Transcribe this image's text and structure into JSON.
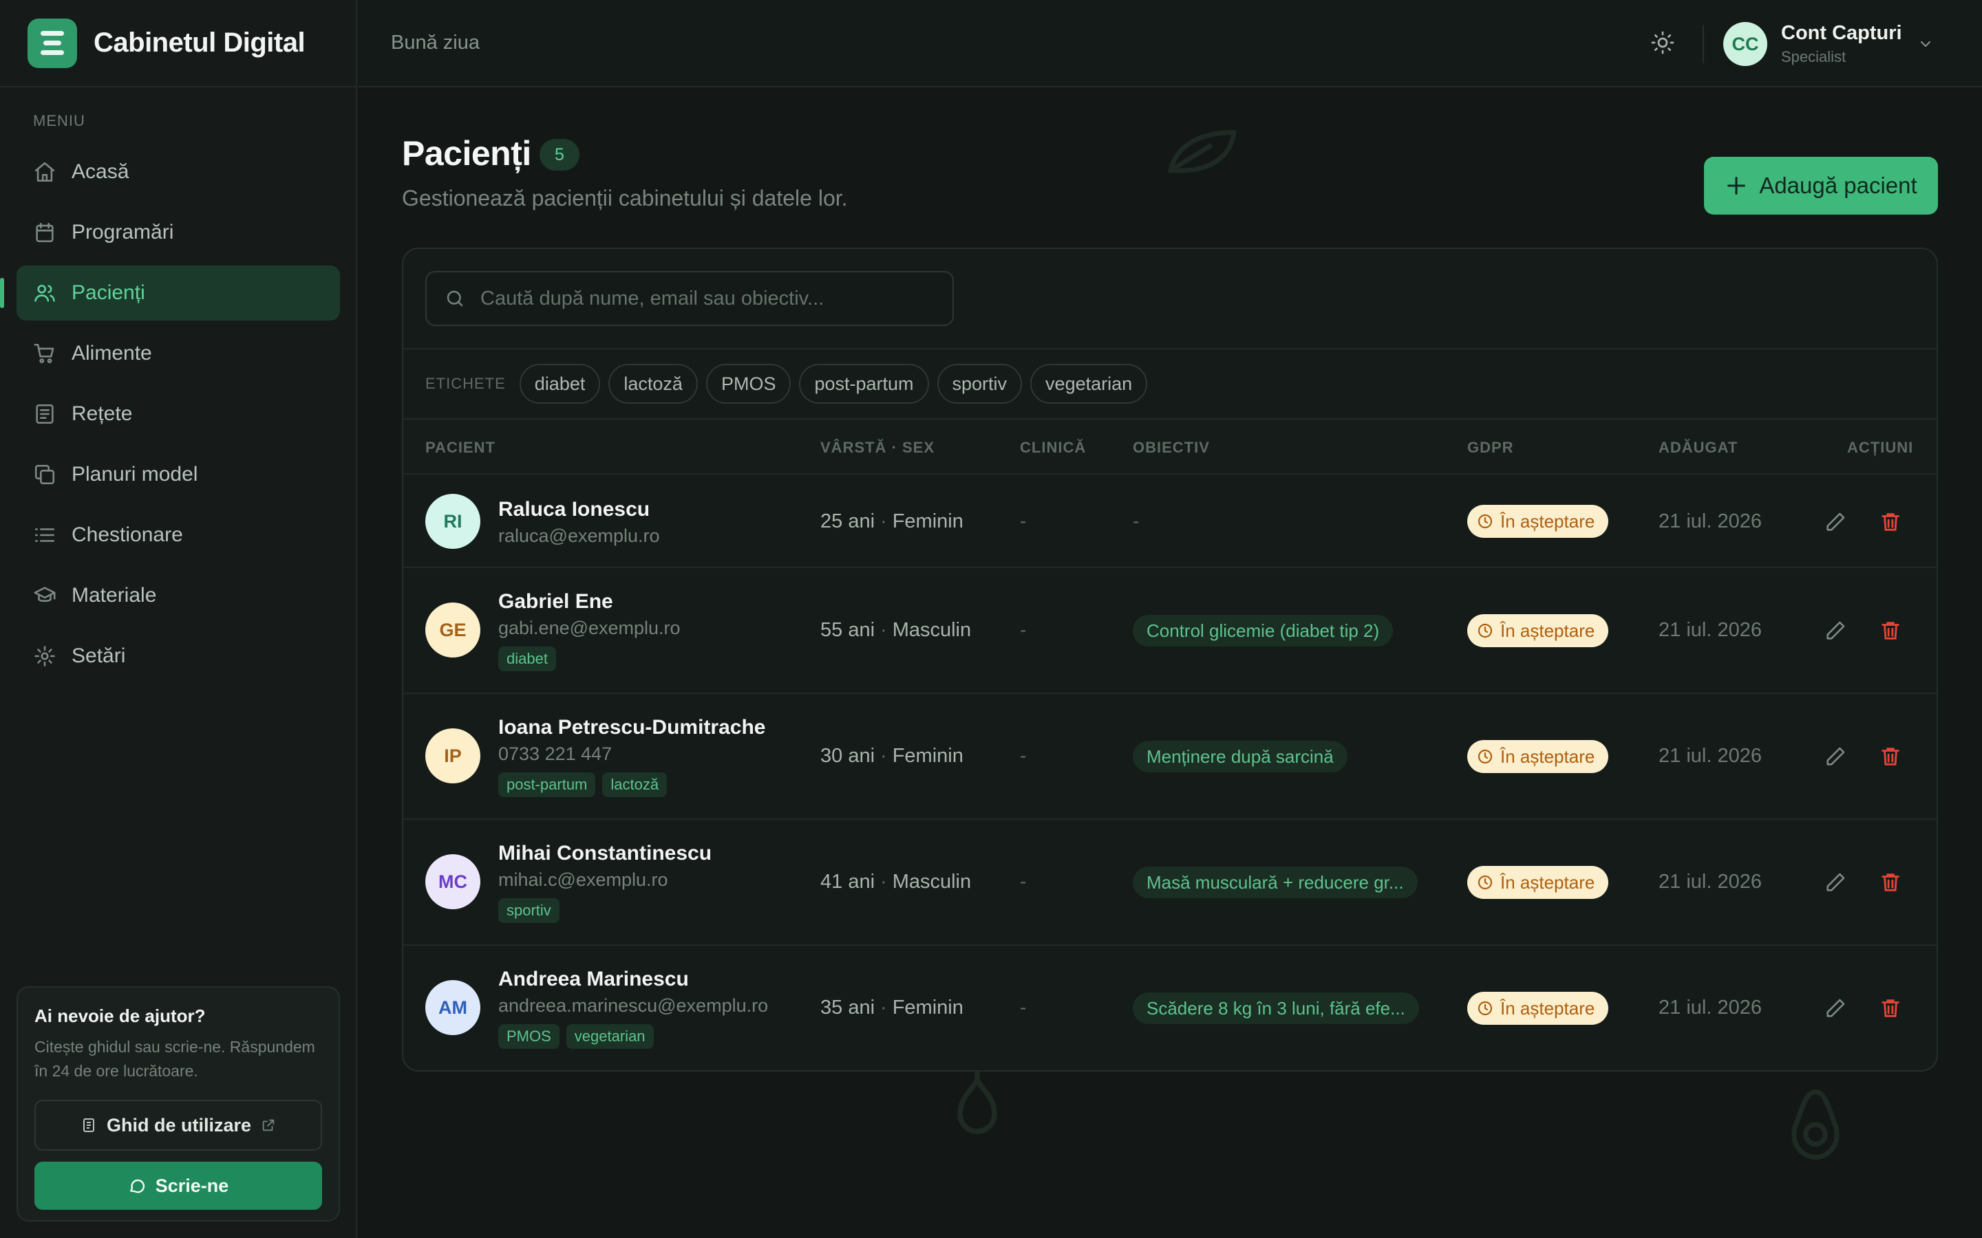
{
  "brand": {
    "name": "Cabinetul Digital"
  },
  "sidebar": {
    "menu_label": "MENIU",
    "items": [
      {
        "label": "Acasă",
        "icon": "home-icon"
      },
      {
        "label": "Programări",
        "icon": "calendar-icon"
      },
      {
        "label": "Pacienți",
        "icon": "users-icon",
        "active": true
      },
      {
        "label": "Alimente",
        "icon": "cart-icon"
      },
      {
        "label": "Rețete",
        "icon": "recipe-icon"
      },
      {
        "label": "Planuri model",
        "icon": "copy-icon"
      },
      {
        "label": "Chestionare",
        "icon": "list-icon"
      },
      {
        "label": "Materiale",
        "icon": "graduation-cap-icon"
      },
      {
        "label": "Setări",
        "icon": "gear-icon"
      }
    ],
    "help": {
      "title": "Ai nevoie de ajutor?",
      "text": "Citește ghidul sau scrie-ne. Răspundem în 24 de ore lucrătoare.",
      "guide_label": "Ghid de utilizare",
      "write_label": "Scrie-ne"
    }
  },
  "topbar": {
    "greeting": "Bună ziua",
    "account": {
      "initials": "CC",
      "name": "Cont Capturi",
      "role": "Specialist"
    }
  },
  "page": {
    "title": "Pacienți",
    "count": "5",
    "subtitle": "Gestionează pacienții cabinetului și datele lor.",
    "add_button": "Adaugă pacient"
  },
  "search": {
    "placeholder": "Caută după nume, email sau obiectiv..."
  },
  "tags": {
    "label": "ETICHETE",
    "items": [
      "diabet",
      "lactoză",
      "PMOS",
      "post-partum",
      "sportiv",
      "vegetarian"
    ]
  },
  "table": {
    "columns": {
      "patient": "PACIENT",
      "age_sex": "VÂRSTĂ · SEX",
      "clinic": "CLINICĂ",
      "objective": "OBIECTIV",
      "gdpr": "GDPR",
      "added": "ADĂUGAT",
      "actions": "ACȚIUNI"
    },
    "rows": [
      {
        "initials": "RI",
        "name": "Raluca Ionescu",
        "contact": "raluca@exemplu.ro",
        "tags": [],
        "age": "25 ani",
        "sex": "Feminin",
        "clinic": "-",
        "objective": "-",
        "gdpr": "În așteptare",
        "added": "21 iul. 2026",
        "avatar_bg": "#d3f5ec",
        "avatar_fg": "#1f7a5e"
      },
      {
        "initials": "GE",
        "name": "Gabriel Ene",
        "contact": "gabi.ene@exemplu.ro",
        "tags": [
          "diabet"
        ],
        "age": "55 ani",
        "sex": "Masculin",
        "clinic": "-",
        "objective": "Control glicemie (diabet tip 2)",
        "gdpr": "În așteptare",
        "added": "21 iul. 2026",
        "avatar_bg": "#fcefc9",
        "avatar_fg": "#a4621a"
      },
      {
        "initials": "IP",
        "name": "Ioana Petrescu-Dumitrache",
        "contact": "0733 221 447",
        "tags": [
          "post-partum",
          "lactoză"
        ],
        "age": "30 ani",
        "sex": "Feminin",
        "clinic": "-",
        "objective": "Menținere după sarcină",
        "gdpr": "În așteptare",
        "added": "21 iul. 2026",
        "avatar_bg": "#fcefc9",
        "avatar_fg": "#a4621a"
      },
      {
        "initials": "MC",
        "name": "Mihai Constantinescu",
        "contact": "mihai.c@exemplu.ro",
        "tags": [
          "sportiv"
        ],
        "age": "41 ani",
        "sex": "Masculin",
        "clinic": "-",
        "objective": "Masă musculară + reducere gr...",
        "gdpr": "În așteptare",
        "added": "21 iul. 2026",
        "avatar_bg": "#ece6fb",
        "avatar_fg": "#6a3fc4"
      },
      {
        "initials": "AM",
        "name": "Andreea Marinescu",
        "contact": "andreea.marinescu@exemplu.ro",
        "tags": [
          "PMOS",
          "vegetarian"
        ],
        "age": "35 ani",
        "sex": "Feminin",
        "clinic": "-",
        "objective": "Scădere 8 kg în 3 luni, fără efe...",
        "gdpr": "În așteptare",
        "added": "21 iul. 2026",
        "avatar_bg": "#dde8fb",
        "avatar_fg": "#2f5fb8"
      }
    ]
  },
  "colors": {
    "accent": "#3fb87c",
    "background": "#131816",
    "danger": "#e2453a",
    "pending_bg": "#fbefcd",
    "pending_fg": "#b05f0f"
  }
}
